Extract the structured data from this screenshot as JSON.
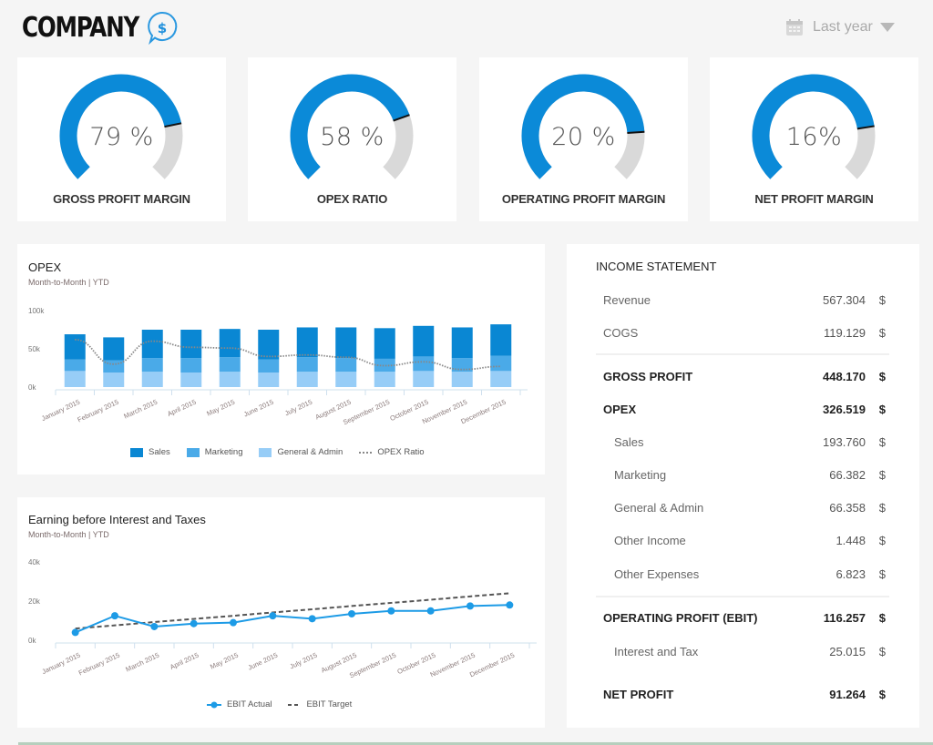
{
  "header": {
    "brand_name": "COMPANY",
    "brand_icon": "dollar-chat-bubble-icon",
    "period_icon": "calendar-icon",
    "period_label": "Last year",
    "period_caret_icon": "caret-down-icon"
  },
  "colors": {
    "accent": "#0b8ad8",
    "sales": "#0a87d3",
    "marketing": "#4aaae8",
    "general_admin": "#97cdf7",
    "gauge_track": "#d9d9d9",
    "ebit_line": "#1d9be6",
    "target_line": "#555555"
  },
  "kpis": [
    {
      "value_text": "79 %",
      "label": "GROSS PROFIT MARGIN",
      "fill_fraction": 0.79
    },
    {
      "value_text": "58 %",
      "label": "OPEX RATIO",
      "fill_fraction": 0.76
    },
    {
      "value_text": "20 %",
      "label": "OPERATING PROFIT MARGIN",
      "fill_fraction": 0.82
    },
    {
      "value_text": "16%",
      "label": "NET PROFIT MARGIN",
      "fill_fraction": 0.8
    }
  ],
  "chart_data": [
    {
      "type": "bar",
      "stacked": true,
      "title": "OPEX",
      "subtitle": "Month-to-Month | YTD",
      "categories": [
        "January 2015",
        "February 2015",
        "March 2015",
        "April 2015",
        "May 2015",
        "June 2015",
        "July 2015",
        "August 2015",
        "September 2015",
        "October 2015",
        "November 2015",
        "December 2015"
      ],
      "y_ticks": [
        "0k",
        "50k",
        "100k"
      ],
      "ylim": [
        0,
        100000
      ],
      "series": [
        {
          "name": "General & Admin",
          "values": [
            21000,
            19000,
            20000,
            19000,
            20000,
            19000,
            20000,
            20000,
            20000,
            21000,
            20000,
            21000
          ]
        },
        {
          "name": "Marketing",
          "values": [
            15000,
            16000,
            18000,
            19000,
            19000,
            17000,
            19000,
            18000,
            17000,
            19000,
            18000,
            20000
          ]
        },
        {
          "name": "Sales",
          "values": [
            33000,
            30000,
            37000,
            37000,
            37000,
            39000,
            39000,
            40000,
            40000,
            40000,
            40000,
            41000
          ]
        },
        {
          "name": "OPEX Ratio",
          "type": "line",
          "style": "dotted",
          "values": [
            62000,
            30000,
            60000,
            52000,
            51000,
            40000,
            42000,
            39000,
            28000,
            33000,
            23000,
            27000
          ]
        }
      ],
      "legend": [
        "Sales",
        "Marketing",
        "General & Admin",
        "OPEX Ratio"
      ],
      "legend_position": "bottom"
    },
    {
      "type": "line",
      "title": "Earning before Interest and Taxes",
      "subtitle": "Month-to-Month | YTD",
      "categories": [
        "January 2015",
        "February 2015",
        "March 2015",
        "April 2015",
        "May 2015",
        "June 2015",
        "July 2015",
        "August 2015",
        "September 2015",
        "October 2015",
        "November 2015",
        "December 2015"
      ],
      "y_ticks": [
        "0k",
        "20k",
        "40k"
      ],
      "ylim": [
        0,
        40000
      ],
      "series": [
        {
          "name": "EBIT Actual",
          "values": [
            4000,
            12500,
            7000,
            8500,
            9000,
            12500,
            11000,
            13500,
            15000,
            15000,
            17500,
            18000
          ]
        },
        {
          "name": "EBIT Target",
          "style": "dashed",
          "values": [
            6000,
            7600,
            9300,
            10900,
            12500,
            14200,
            15800,
            17500,
            19100,
            20700,
            22400,
            24000
          ]
        }
      ],
      "legend": [
        "EBIT Actual",
        "EBIT Target"
      ],
      "legend_position": "bottom"
    }
  ],
  "income_statement": {
    "title": "INCOME STATEMENT",
    "rows": [
      {
        "label": "Revenue",
        "value": "567.304",
        "currency": "$"
      },
      {
        "label": "COGS",
        "value": "119.129",
        "currency": "$"
      },
      {
        "label": "GROSS PROFIT",
        "value": "448.170",
        "currency": "$"
      },
      {
        "label": "OPEX",
        "value": "326.519",
        "currency": "$"
      },
      {
        "label": "Sales",
        "value": "193.760",
        "currency": "$"
      },
      {
        "label": "Marketing",
        "value": "66.382",
        "currency": "$"
      },
      {
        "label": "General & Admin",
        "value": "66.358",
        "currency": "$"
      },
      {
        "label": "Other Income",
        "value": "1.448",
        "currency": "$"
      },
      {
        "label": "Other Expenses",
        "value": "6.823",
        "currency": "$"
      },
      {
        "label": "OPERATING PROFIT (EBIT)",
        "value": "116.257",
        "currency": "$"
      },
      {
        "label": "Interest and Tax",
        "value": "25.015",
        "currency": "$"
      },
      {
        "label": "NET PROFIT",
        "value": "91.264",
        "currency": "$"
      }
    ]
  }
}
